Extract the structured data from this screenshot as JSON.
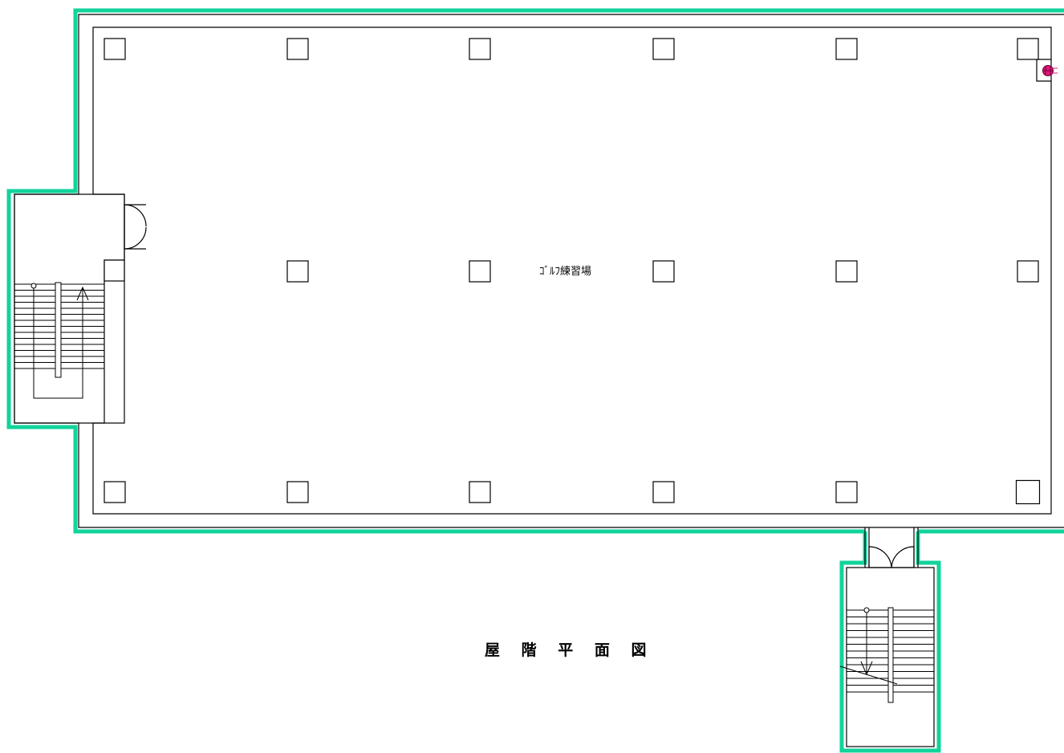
{
  "plan": {
    "title": "屋 階 平 面 図",
    "room_label": "ｺﾞﾙﾌ練習場"
  },
  "colors": {
    "outline_accent": "#11d39b",
    "wall_line": "#000000",
    "background": "#ffffff",
    "marker": "#e0177a"
  },
  "icons": {
    "column": "square-column-icon",
    "door": "double-swing-door-icon",
    "stair_arrow": "arrow-icon",
    "marker": "red-circle-marker-icon"
  }
}
